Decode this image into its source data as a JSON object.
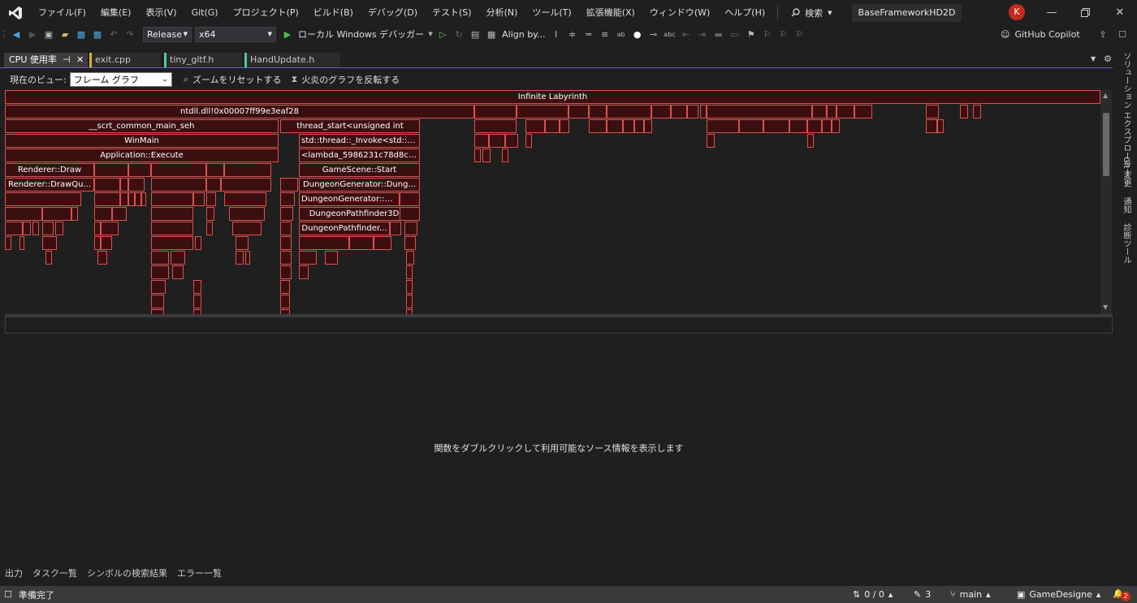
{
  "menu": [
    "ファイル(F)",
    "編集(E)",
    "表示(V)",
    "Git(G)",
    "プロジェクト(P)",
    "ビルド(B)",
    "デバッグ(D)",
    "テスト(S)",
    "分析(N)",
    "ツール(T)",
    "拡張機能(X)",
    "ウィンドウ(W)",
    "ヘルプ(H)"
  ],
  "search_label": "検索",
  "solution_name": "BaseFrameworkHD2D",
  "user_initial": "K",
  "toolbar": {
    "configuration": "Release",
    "platform": "x64",
    "debugger": "ローカル Windows デバッガー",
    "align": "Align by...",
    "copilot": "GitHub Copilot"
  },
  "tabs": [
    {
      "label": "CPU 使用率",
      "active": true,
      "color": "#d4b72b"
    },
    {
      "label": "exit.cpp",
      "active": false,
      "color": "#d4b72b"
    },
    {
      "label": "tiny_gltf.h",
      "active": false,
      "color": "#4ec9b0"
    },
    {
      "label": "HandUpdate.h",
      "active": false,
      "color": "#4ec9b0"
    }
  ],
  "view": {
    "label": "現在のビュー:",
    "selected": "フレーム グラフ",
    "reset_zoom": "ズームをリセットする",
    "invert_flame": "火炎のグラフを反転する"
  },
  "flame_frames": [
    "Infinite Labyrinth",
    "ntdll.dll!0x00007ff99e3eaf28",
    "__scrt_common_main_seh",
    "WinMain",
    "Application::Execute",
    "Renderer::Draw",
    "Renderer::DrawQu...",
    "thread_start<unsigned int",
    "std::thread::_Invoke<std::tu...",
    "<lambda_5986231c78d8c2...",
    "GameScene::Start",
    "DungeonGenerator::Dung...",
    "DungeonGenerator::Pa...",
    "DungeonPathfinder3D:...",
    "DungeonPathfinder..."
  ],
  "source_message": "関数をダブルクリックして利用可能なソース情報を表示します",
  "rail": [
    "ソリューション エクスプローラー",
    "Git 変更",
    "通知",
    "診断ツール"
  ],
  "bottom_tabs": [
    "出力",
    "タスク一覧",
    "シンボルの検索結果",
    "エラー一覧"
  ],
  "status": {
    "ready": "準備完了",
    "sync": "0 / 0",
    "edits": "3",
    "branch": "main",
    "repo": "GameDesigne",
    "notifications": "2"
  }
}
